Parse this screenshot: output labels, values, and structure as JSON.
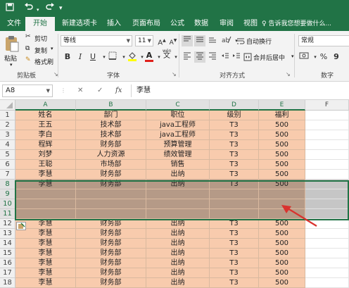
{
  "titlebar": {
    "quick_access": [
      "save-icon",
      "undo-icon",
      "redo-icon",
      "customize-qa-icon"
    ]
  },
  "tabs": [
    {
      "label": "文件",
      "active": false
    },
    {
      "label": "开始",
      "active": true
    },
    {
      "label": "新建选项卡",
      "active": false
    },
    {
      "label": "插入",
      "active": false
    },
    {
      "label": "页面布局",
      "active": false
    },
    {
      "label": "公式",
      "active": false
    },
    {
      "label": "数据",
      "active": false
    },
    {
      "label": "审阅",
      "active": false
    },
    {
      "label": "视图",
      "active": false
    }
  ],
  "tell_me": "♀ 告诉我您想要做什么...",
  "ribbon": {
    "clipboard": {
      "paste": "粘贴",
      "cut": "剪切",
      "copy": "复制",
      "format_painter": "格式刷",
      "group_label": "剪贴板"
    },
    "font": {
      "font_name": "等线",
      "font_size": "11",
      "bold": "B",
      "italic": "I",
      "underline": "U",
      "font_color_glyph": "A",
      "wen": "wén",
      "group_label": "字体"
    },
    "alignment": {
      "wrap_text": "自动换行",
      "merge_center": "合并后居中",
      "group_label": "对齐方式"
    },
    "number": {
      "format": "常规",
      "percent": "%",
      "comma": "9",
      "group_label": "数字"
    }
  },
  "formula_bar": {
    "name_box": "A8",
    "cancel": "✕",
    "confirm": "✓",
    "fx": "fx",
    "value": "李慧"
  },
  "columns": [
    "A",
    "B",
    "C",
    "D",
    "E",
    "F"
  ],
  "rows": [
    {
      "num": "1",
      "cells": [
        "姓名",
        "部门",
        "职位",
        "级别",
        "福利"
      ]
    },
    {
      "num": "2",
      "cells": [
        "王五",
        "技术部",
        "java工程师",
        "T3",
        "500"
      ]
    },
    {
      "num": "3",
      "cells": [
        "李白",
        "技术部",
        "java工程师",
        "T3",
        "500"
      ]
    },
    {
      "num": "4",
      "cells": [
        "程辉",
        "财务部",
        "预算管理",
        "T3",
        "500"
      ]
    },
    {
      "num": "5",
      "cells": [
        "刘梦",
        "人力资源",
        "绩效管理",
        "T3",
        "500"
      ]
    },
    {
      "num": "6",
      "cells": [
        "王聪",
        "市场部",
        "销售",
        "T3",
        "500"
      ]
    },
    {
      "num": "7",
      "cells": [
        "李慧",
        "财务部",
        "出纳",
        "T3",
        "500"
      ]
    },
    {
      "num": "8",
      "cells": [
        "李慧",
        "财务部",
        "出纳",
        "T3",
        "500"
      ]
    },
    {
      "num": "9",
      "cells": [
        "",
        "",
        "",
        "",
        ""
      ]
    },
    {
      "num": "10",
      "cells": [
        "",
        "",
        "",
        "",
        ""
      ]
    },
    {
      "num": "11",
      "cells": [
        "",
        "",
        "",
        "",
        ""
      ]
    },
    {
      "num": "12",
      "cells": [
        "李慧",
        "财务部",
        "出纳",
        "T3",
        "500"
      ]
    },
    {
      "num": "13",
      "cells": [
        "李慧",
        "财务部",
        "出纳",
        "T3",
        "500"
      ]
    },
    {
      "num": "14",
      "cells": [
        "李慧",
        "财务部",
        "出纳",
        "T3",
        "500"
      ]
    },
    {
      "num": "15",
      "cells": [
        "李慧",
        "财务部",
        "出纳",
        "T3",
        "500"
      ]
    },
    {
      "num": "16",
      "cells": [
        "李慧",
        "财务部",
        "出纳",
        "T3",
        "500"
      ]
    },
    {
      "num": "17",
      "cells": [
        "李慧",
        "财务部",
        "出纳",
        "T3",
        "500"
      ]
    },
    {
      "num": "18",
      "cells": [
        "李慧",
        "财务部",
        "出纳",
        "T3",
        "500"
      ]
    }
  ],
  "selected_rows": [
    "8",
    "9",
    "10",
    "11"
  ],
  "colors": {
    "accent": "#217346",
    "cell_fill": "#f8cbad",
    "selected_fill": "#b59a87",
    "arrow": "#d9332f"
  }
}
